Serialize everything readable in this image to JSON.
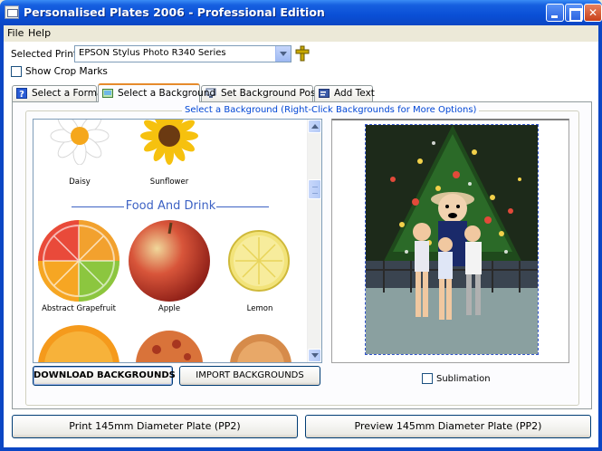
{
  "window": {
    "title": "Personalised Plates 2006 - Professional Edition"
  },
  "menu": {
    "items": [
      "File",
      "Help"
    ]
  },
  "printer": {
    "label": "Selected Printer",
    "value": "EPSON Stylus Photo R340 Series"
  },
  "crop_marks": {
    "label": "Show Crop Marks",
    "checked": false
  },
  "tabs": [
    {
      "label": "Select a Format",
      "active": false
    },
    {
      "label": "Select a Background",
      "active": true
    },
    {
      "label": "Set Background Position",
      "active": false
    },
    {
      "label": "Add Text",
      "active": false
    }
  ],
  "backgrounds": {
    "group_title": "Select a Background (Right-Click Backgrounds for More Options)",
    "flowers": [
      "Daisy",
      "Sunflower"
    ],
    "category": "Food And Drink",
    "food": [
      "Abstract Grapefruit",
      "Apple",
      "Lemon"
    ],
    "download_label": "DOWNLOAD BACKGROUNDS",
    "import_label": "IMPORT BACKGROUNDS"
  },
  "sublimation": {
    "label": "Sublimation",
    "checked": false
  },
  "actions": {
    "print_label": "Print 145mm Diameter Plate (PP2)",
    "preview_label": "Preview 145mm Diameter Plate (PP2)"
  },
  "colors": {
    "accent": "#0046d5",
    "title_bar": "#0b46c4",
    "tab_highlight": "#e68b2c"
  }
}
